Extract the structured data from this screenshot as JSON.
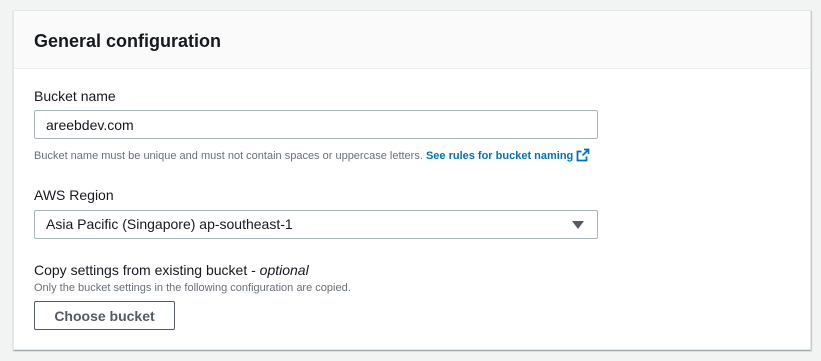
{
  "panel": {
    "title": "General configuration"
  },
  "bucket_name": {
    "label": "Bucket name",
    "value": "areebdev.com",
    "hint": "Bucket name must be unique and must not contain spaces or uppercase letters.",
    "link_label": "See rules for bucket naming",
    "link_icon": "external-link-icon"
  },
  "region": {
    "label": "AWS Region",
    "selected": "Asia Pacific (Singapore) ap-southeast-1",
    "arrow_icon": "caret-down-icon"
  },
  "copy_settings": {
    "label": "Copy settings from existing bucket - ",
    "label_optional": "optional",
    "hint": "Only the bucket settings in the following configuration are copied.",
    "button_label": "Choose bucket"
  },
  "colors": {
    "link": "#0073bb",
    "text": "#16191f",
    "hint": "#687078",
    "border": "#aab7b8"
  }
}
